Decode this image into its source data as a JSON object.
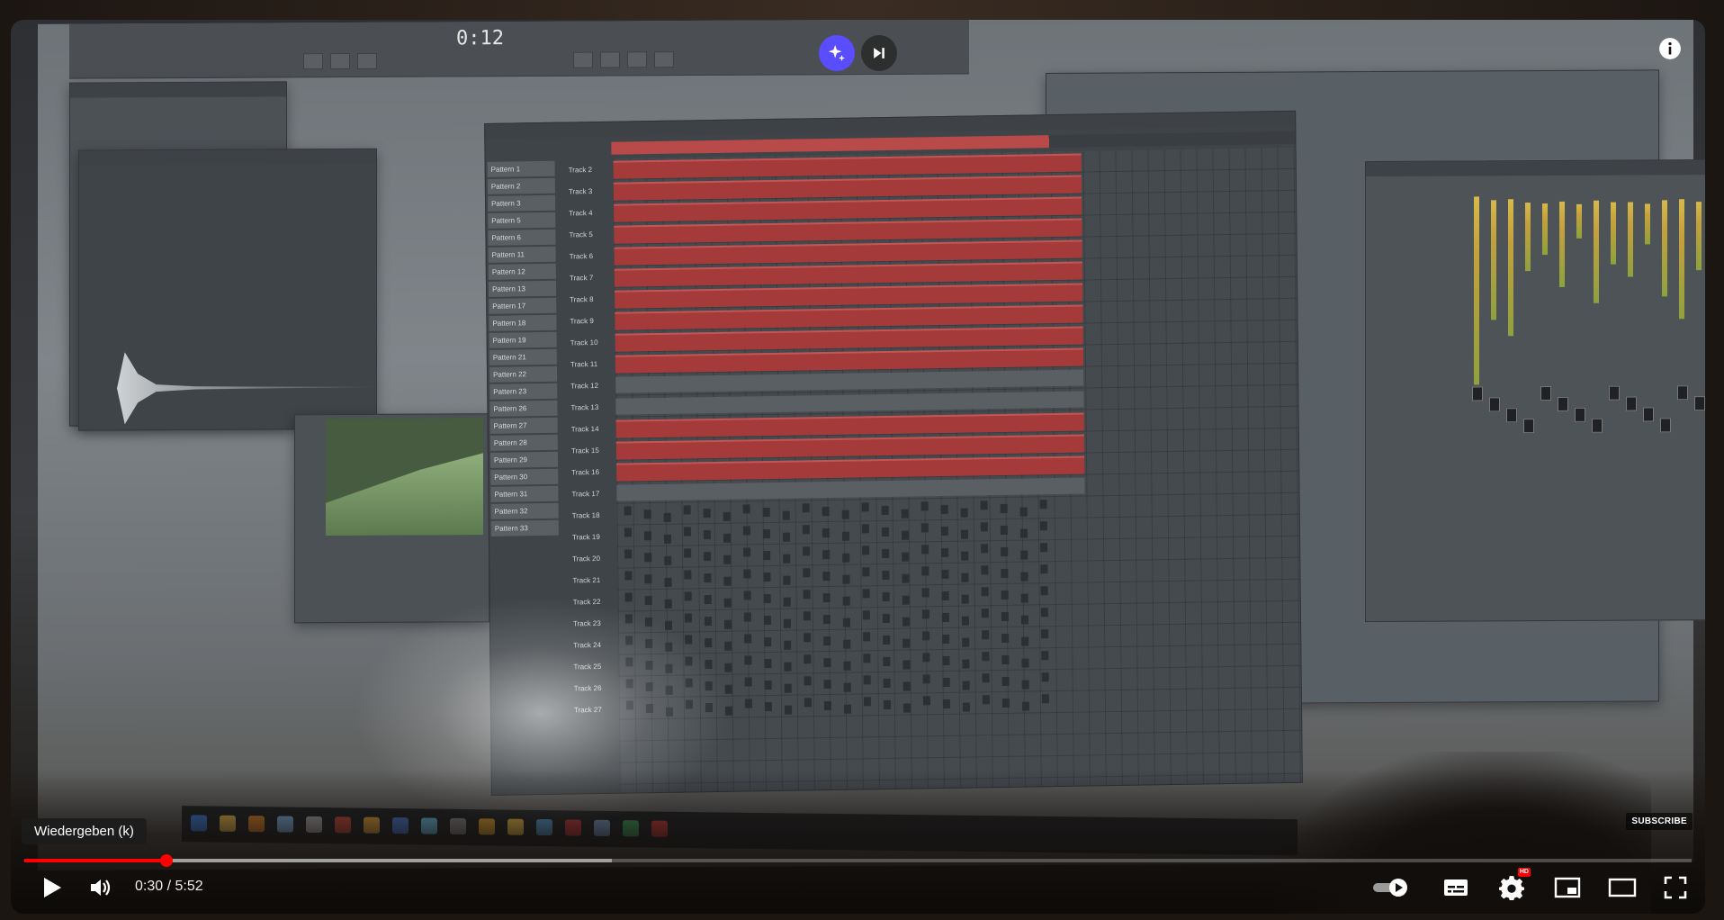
{
  "player": {
    "tooltip": "Wiedergeben (k)",
    "time_current": "0:30",
    "time_separator": " / ",
    "time_total": "5:52",
    "progress_played_fraction": 0.0853,
    "progress_buffered_fraction": 0.3525,
    "subscribe_label": "SUBSCRIBE",
    "hd_label": "HD",
    "accent_color": "#ff0000",
    "ai_button_color": "#5a4cff"
  },
  "icons": {
    "ai": "sparkles-icon",
    "next": "skip-next-icon",
    "info": "info-icon",
    "play": "play-icon",
    "volume": "volume-icon",
    "autoplay": "autoplay-toggle-icon",
    "subtitles": "subtitles-icon",
    "settings": "gear-icon",
    "miniplayer": "miniplayer-icon",
    "theater": "theater-mode-icon",
    "fullscreen": "fullscreen-icon"
  },
  "video": {
    "daw_time": "0:12",
    "playlist_tracks": [
      "Track 2",
      "Track 3",
      "Track 4",
      "Track 5",
      "Track 6",
      "Track 7",
      "Track 8",
      "Track 9",
      "Track 10",
      "Track 11",
      "Track 12",
      "Track 13",
      "Track 14",
      "Track 15",
      "Track 16",
      "Track 17",
      "Track 18",
      "Track 19",
      "Track 20",
      "Track 21",
      "Track 22",
      "Track 23",
      "Track 24",
      "Track 25",
      "Track 26",
      "Track 27"
    ],
    "patterns": [
      "Pattern 1",
      "Pattern 2",
      "Pattern 3",
      "Pattern 5",
      "Pattern 6",
      "Pattern 11",
      "Pattern 12",
      "Pattern 13",
      "Pattern 17",
      "Pattern 18",
      "Pattern 19",
      "Pattern 21",
      "Pattern 22",
      "Pattern 23",
      "Pattern 26",
      "Pattern 27",
      "Pattern 28",
      "Pattern 29",
      "Pattern 30",
      "Pattern 31",
      "Pattern 32",
      "Pattern 33"
    ]
  }
}
